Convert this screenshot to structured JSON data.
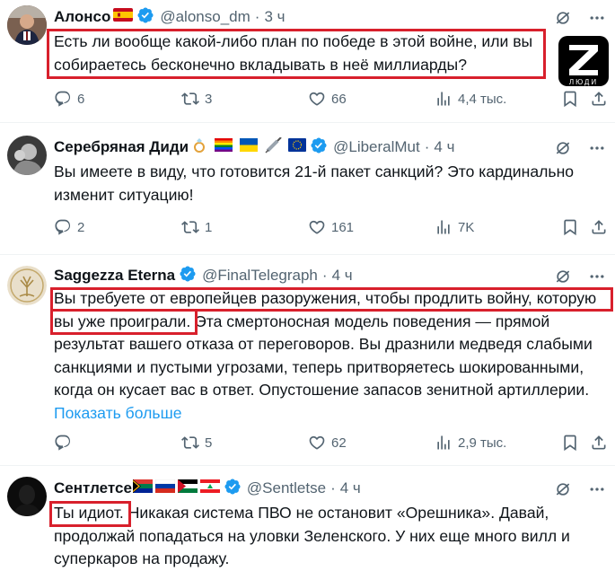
{
  "tweets": [
    {
      "name": "Алонсо",
      "handle": "@alonso_dm",
      "dot": "·",
      "time": "3 ч",
      "lines": [
        "Есть ли вообще какой-либо план по победе в этой войне, или вы",
        "собираетесь бесконечно вкладывать в неё миллиарды?"
      ],
      "replies": "6",
      "retweets": "3",
      "likes": "66",
      "views": "4,4 тыс.",
      "watermark_text": "ЛЮДИ"
    },
    {
      "name": "Серебряная Диди",
      "handle": "@LiberalMut",
      "dot": "·",
      "time": "4 ч",
      "lines": [
        "Вы имеете в виду, что готовится 21-й пакет санкций? Это кардинально",
        "изменит ситуацию!"
      ],
      "replies": "2",
      "retweets": "1",
      "likes": "161",
      "views": "7K"
    },
    {
      "name": "Saggezza Eterna",
      "handle": "@FinalTelegraph",
      "dot": "·",
      "time": "4 ч",
      "lines": [
        "Вы требуете от европейцев разоружения, чтобы продлить войну, которую",
        "вы уже проиграли. Эта смертоносная модель поведения — прямой",
        "результат вашего отказа от переговоров. Вы дразнили медведя слабыми",
        "санкциями и пустыми угрозами, теперь притворяетесь шокированными,",
        "когда он кусает вас в ответ. Опустошение запасов зенитной артиллерии."
      ],
      "show_more": "Показать больше",
      "replies": "",
      "retweets": "5",
      "likes": "62",
      "views": "2,9 тыс."
    },
    {
      "name": "Сентлетсе",
      "handle": "@Sentletse",
      "dot": "·",
      "time": "4 ч",
      "lines": [
        "Ты идиот. Никакая система ПВО не остановит «Орешника». Давай,",
        "продолжай попадаться на уловки Зеленского. У них еще много вилл и",
        "суперкаров на продажу."
      ]
    }
  ],
  "colors": {
    "highlight": "#d8202c",
    "verified": "#1d9bf0",
    "secondary_text": "#536471",
    "link": "#1d9bf0"
  },
  "icons": [
    "grok-icon",
    "more-icon",
    "reply-icon",
    "retweet-icon",
    "like-icon",
    "views-icon",
    "bookmark-icon",
    "share-icon",
    "verified-badge-icon"
  ]
}
